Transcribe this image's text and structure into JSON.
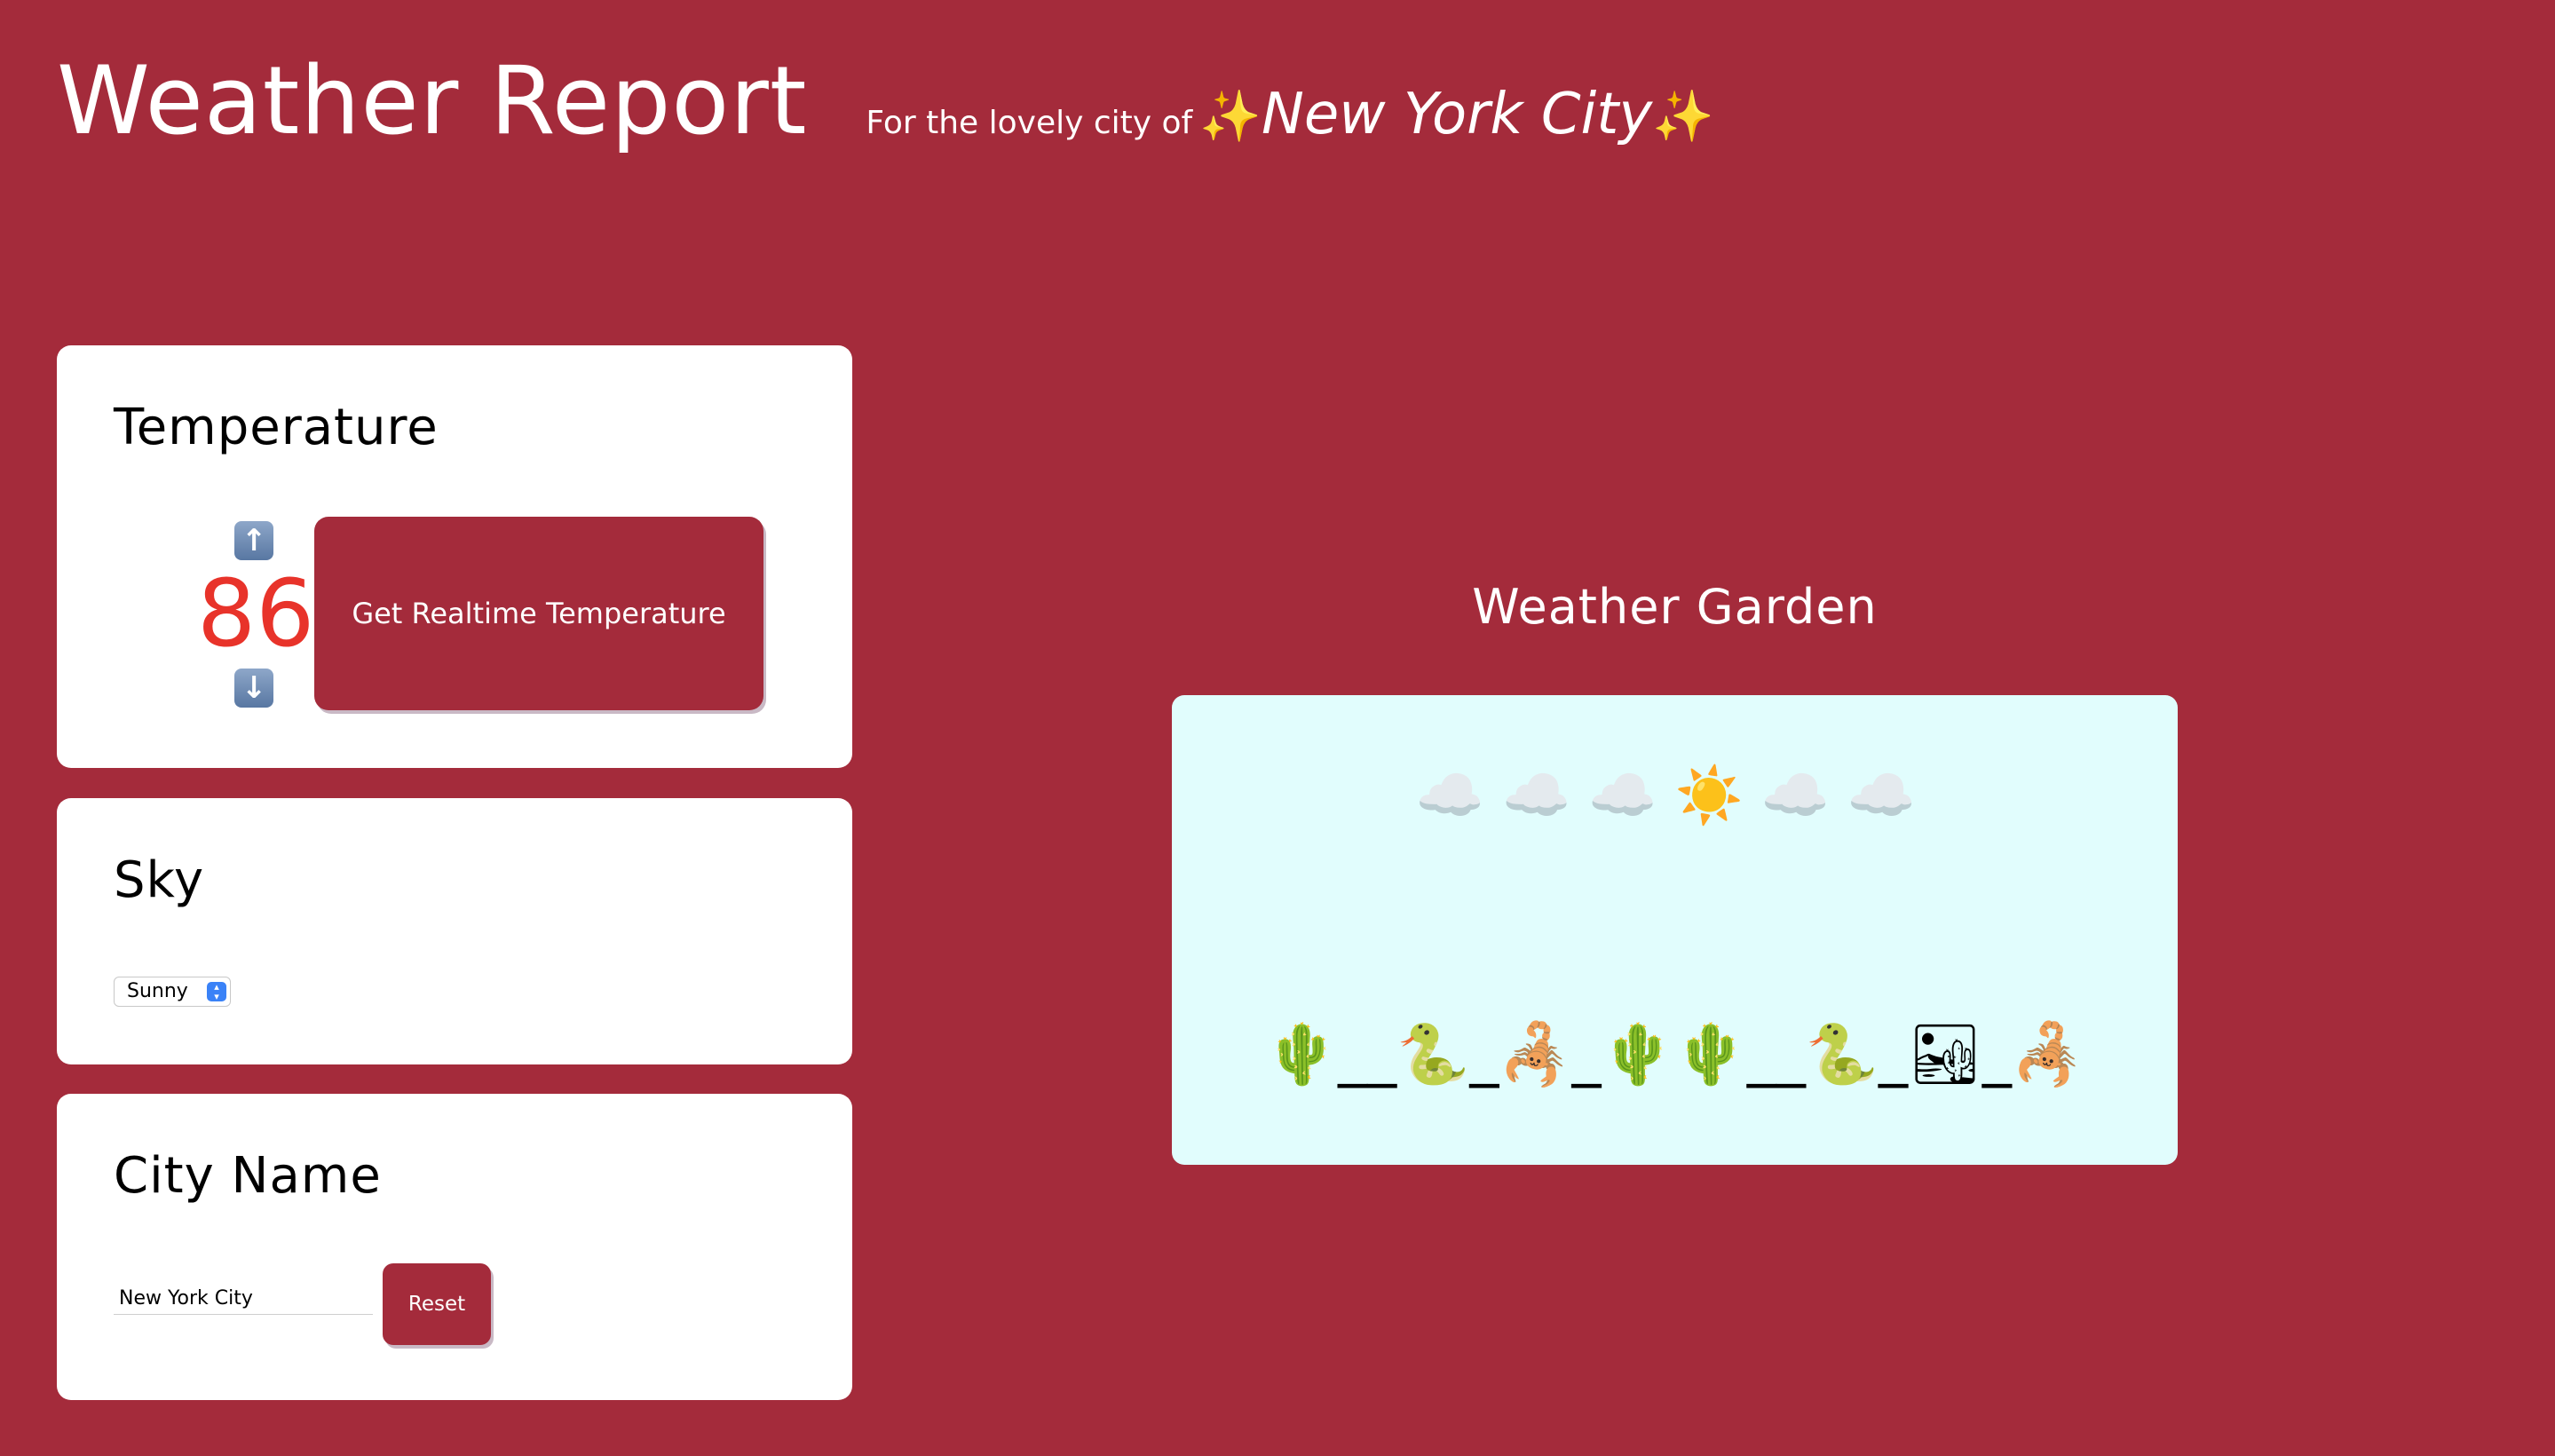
{
  "header": {
    "title": "Weather Report",
    "subtitle_prefix": "For the lovely city of",
    "sparkle_left": "✨",
    "city": "New York City",
    "sparkle_right": "✨"
  },
  "temperature": {
    "title": "Temperature",
    "value": "86",
    "up_icon": "⬆️",
    "down_icon": "⬇️",
    "realtime_button": "Get Realtime Temperature",
    "color": "#e8332a"
  },
  "sky": {
    "title": "Sky",
    "selected": "Sunny",
    "chevron": "⌃⌄"
  },
  "city_name": {
    "title": "City Name",
    "input_value": "New York City",
    "reset_button": "Reset"
  },
  "garden": {
    "title": "Weather Garden",
    "sky_emojis": "☁️☁️☁️☀️☁️☁️",
    "landscape_emojis": "🌵__🐍_🦂_🌵🌵__🐍_🏜_🦂",
    "background": "#e1fdfd"
  },
  "colors": {
    "page_background": "#a42b3b",
    "button_background": "#a42b3b",
    "card_background": "#ffffff"
  }
}
